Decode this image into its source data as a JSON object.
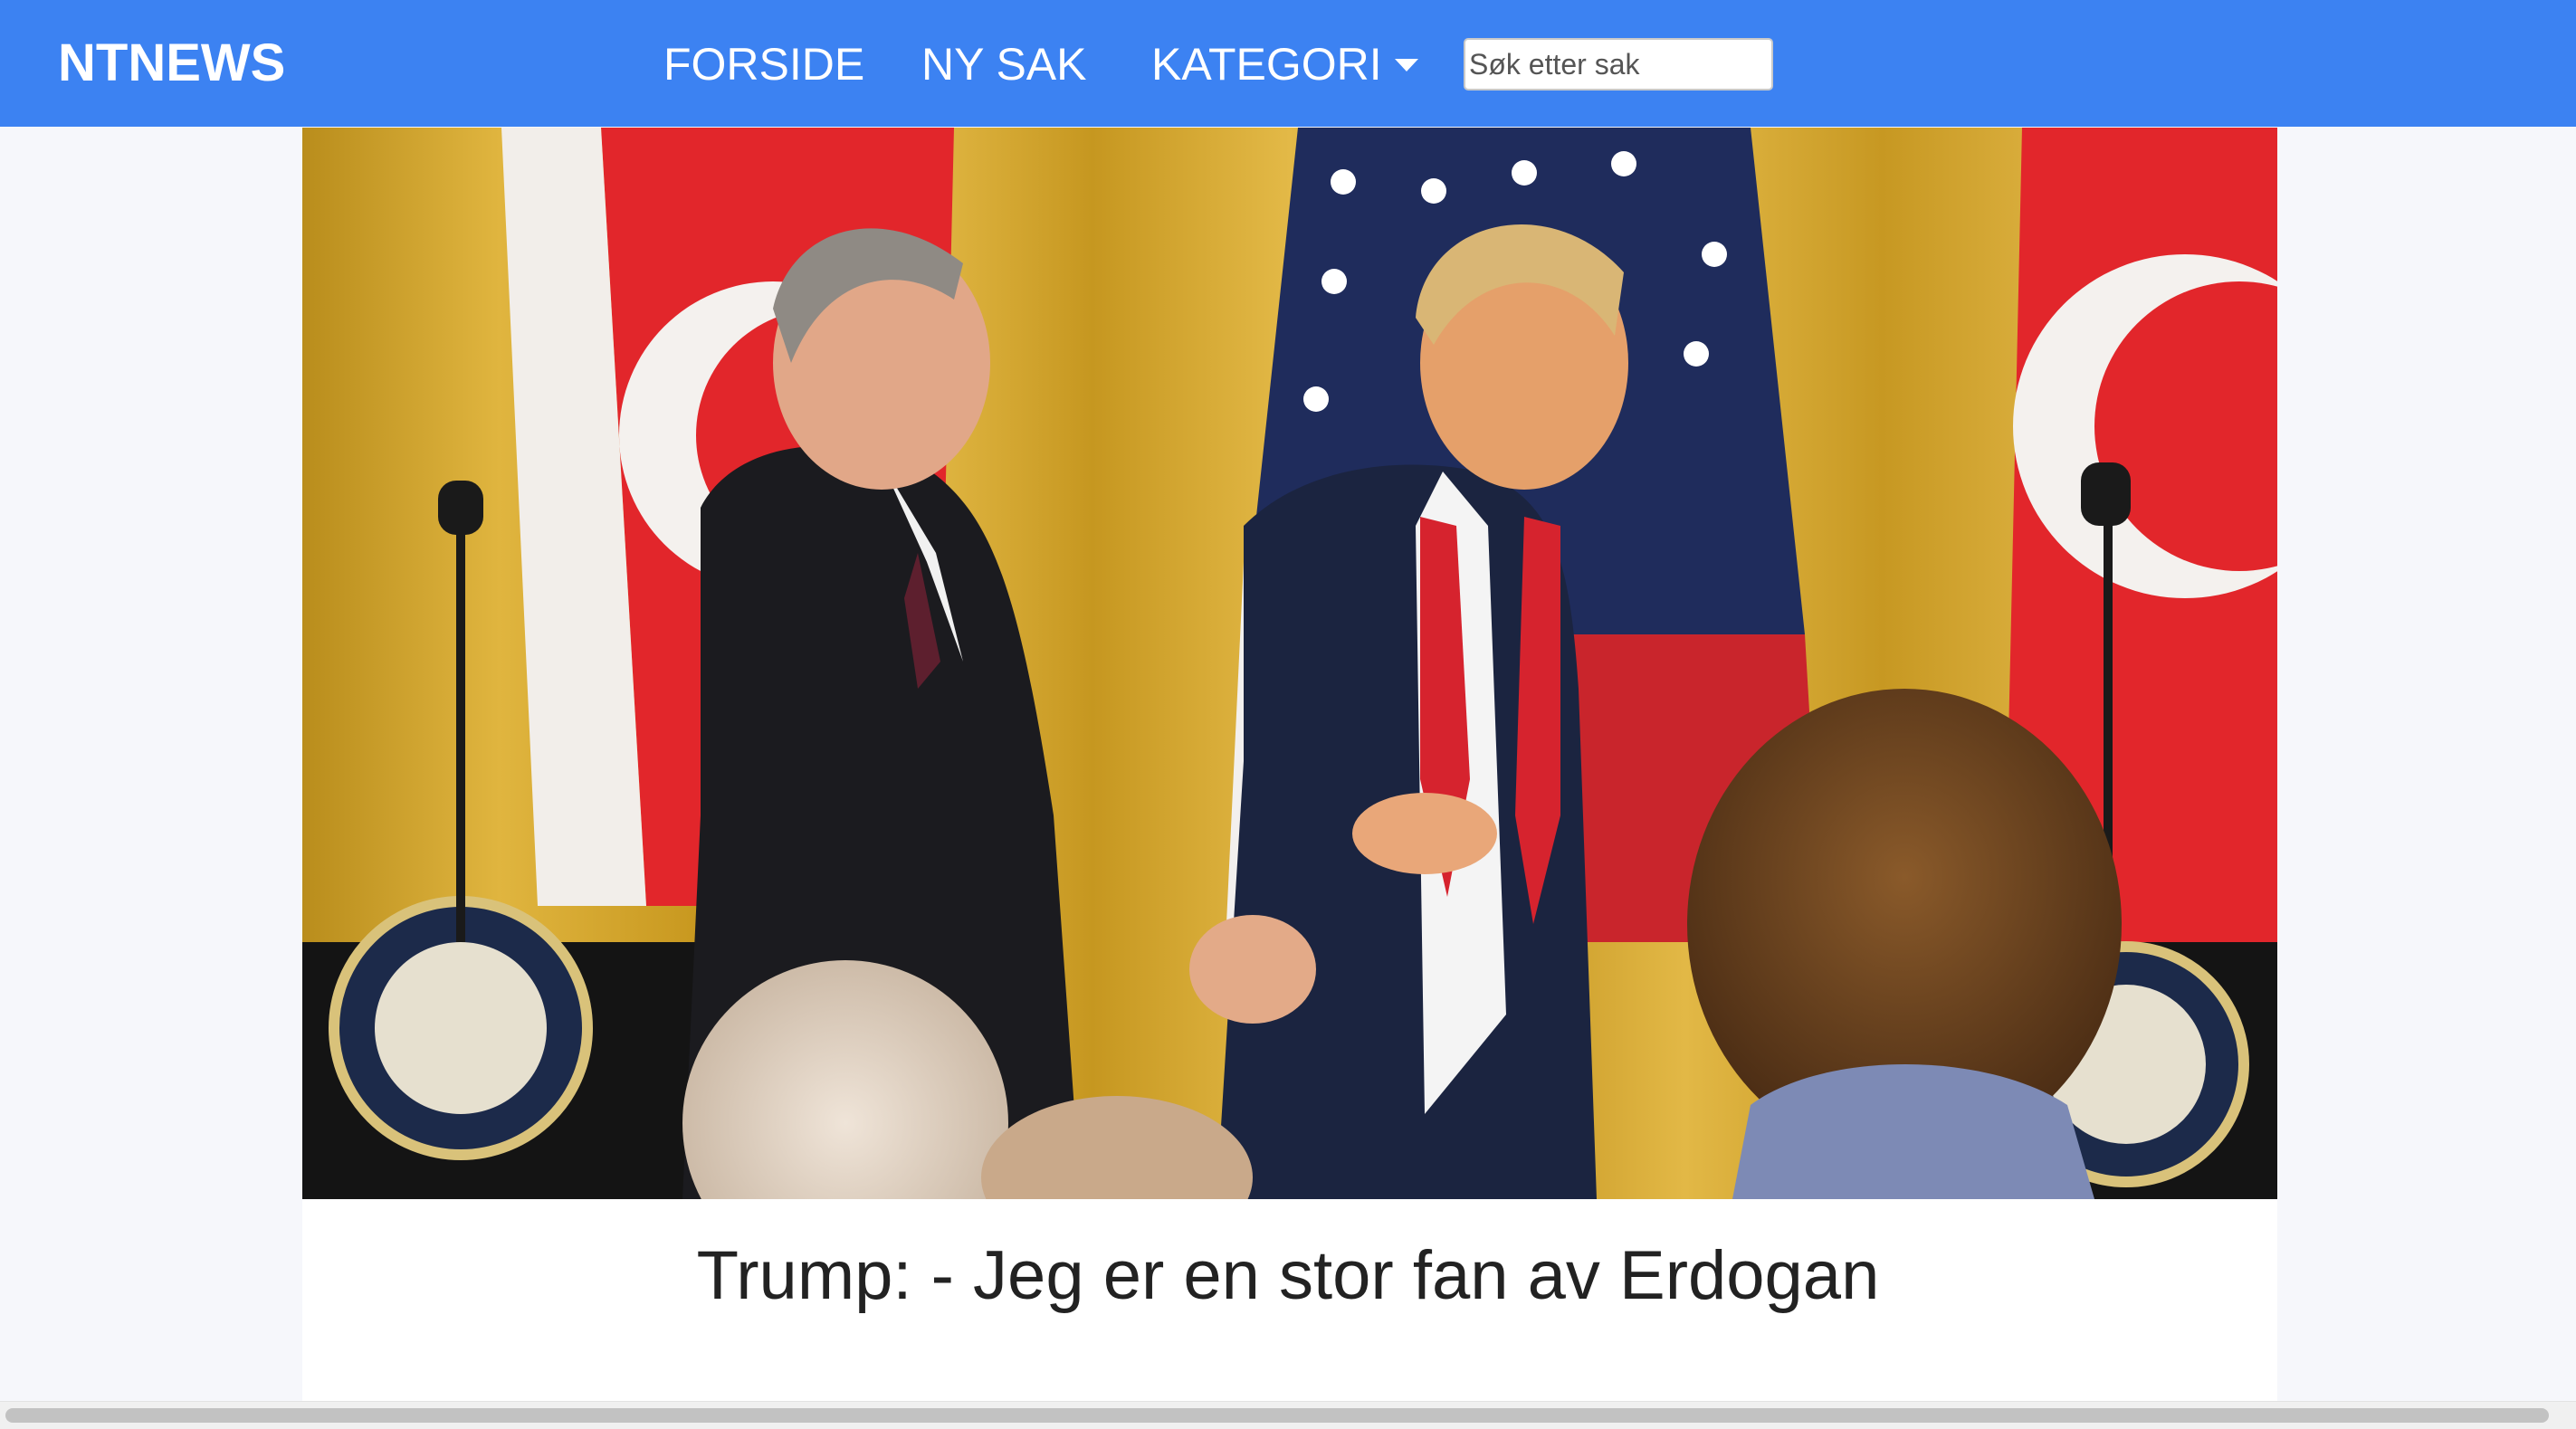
{
  "nav": {
    "brand": "NTNEWS",
    "links": [
      "FORSIDE",
      "NY SAK",
      "KATEGORI"
    ],
    "search_placeholder": "Søk etter sak"
  },
  "article": {
    "title": "Trump: - Jeg er en stor fan av Erdogan"
  },
  "colors": {
    "navbar": "#3c82f2",
    "page_background": "#f6f7fb"
  },
  "icons": {
    "dropdown": "caret-down-icon"
  }
}
